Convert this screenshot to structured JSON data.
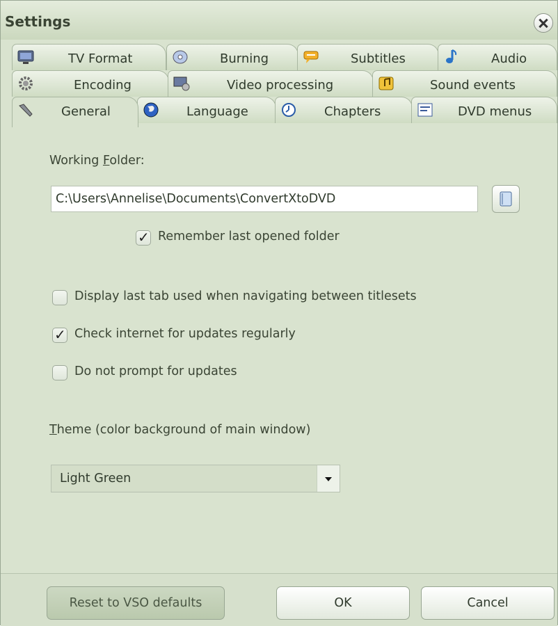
{
  "window": {
    "title": "Settings"
  },
  "tabs": {
    "row1": [
      {
        "label": "TV Format",
        "icon": "tv-icon"
      },
      {
        "label": "Burning",
        "icon": "disc-icon"
      },
      {
        "label": "Subtitles",
        "icon": "subtitles-icon"
      },
      {
        "label": "Audio",
        "icon": "music-note-icon"
      }
    ],
    "row2": [
      {
        "label": "Encoding",
        "icon": "gear-icon"
      },
      {
        "label": "Video processing",
        "icon": "video-processing-icon"
      },
      {
        "label": "Sound events",
        "icon": "sound-events-icon"
      }
    ],
    "row3": [
      {
        "label": "General",
        "icon": "wrench-icon",
        "active": true
      },
      {
        "label": "Language",
        "icon": "globe-icon"
      },
      {
        "label": "Chapters",
        "icon": "clock-icon"
      },
      {
        "label": "DVD menus",
        "icon": "menu-icon"
      }
    ]
  },
  "general": {
    "working_folder_label_prefix": "Working ",
    "working_folder_label_hotkey": "F",
    "working_folder_label_suffix": "older:",
    "working_folder_value": "C:\\Users\\Annelise\\Documents\\ConvertXtoDVD",
    "remember_folder": {
      "label": "Remember last opened folder",
      "checked": true
    },
    "display_last_tab": {
      "label": "Display last tab used when navigating between titlesets",
      "checked": false
    },
    "check_updates": {
      "label": "Check internet for updates regularly",
      "checked": true
    },
    "no_prompt_updates": {
      "label": "Do not prompt for updates",
      "checked": false
    },
    "theme_label_hotkey": "T",
    "theme_label_rest": "heme (color background of main window)",
    "theme_value": "Light Green"
  },
  "footer": {
    "reset_label": "Reset to VSO defaults",
    "ok_label": "OK",
    "cancel_label": "Cancel"
  },
  "colors": {
    "background": "#d9e3cf",
    "titlebar": "#cbd8be",
    "border": "#a9b7a1"
  }
}
